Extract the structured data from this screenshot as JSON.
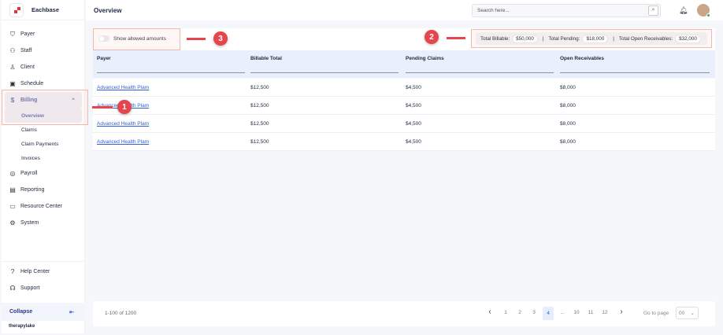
{
  "brand": "Eachbase",
  "sidebar": {
    "items": [
      {
        "label": "Payer",
        "icon": "shield-icon"
      },
      {
        "label": "Staff",
        "icon": "staff-icon"
      },
      {
        "label": "Client",
        "icon": "client-icon"
      },
      {
        "label": "Schedule",
        "icon": "calendar-icon"
      },
      {
        "label": "Billing",
        "icon": "billing-icon"
      }
    ],
    "billing_sub": [
      "Overview",
      "Claims",
      "Claim Payments",
      "Invoices"
    ],
    "items2": [
      {
        "label": "Payroll",
        "icon": "payroll-icon"
      },
      {
        "label": "Reporting",
        "icon": "report-icon"
      },
      {
        "label": "Resource Center",
        "icon": "folder-icon"
      },
      {
        "label": "System",
        "icon": "gear-icon"
      }
    ],
    "help": "Help Center",
    "support": "Support",
    "collapse": "Collapse",
    "footer_logo": "therapylake"
  },
  "header": {
    "title": "Overview",
    "search_placeholder": "Search here..."
  },
  "toggle_label": "Show allowed amounts",
  "totals": {
    "billable_label": "Total Billable:",
    "billable": "$50,000",
    "pending_label": "Total Pending:",
    "pending": "$18,000",
    "open_label": "Total Open Receivables:",
    "open": "$32,000",
    "sep": "|"
  },
  "table": {
    "columns": [
      "Payer",
      "Billable Total",
      "Pending Claims",
      "Open Receivables"
    ],
    "rows": [
      [
        "Advanced Health Plam",
        "$12,500",
        "$4,500",
        "$8,000"
      ],
      [
        "Advanced Health Plam",
        "$12,500",
        "$4,500",
        "$8,000"
      ],
      [
        "Advanced Health Plam",
        "$12,500",
        "$4,500",
        "$8,000"
      ],
      [
        "Advanced Health Plam",
        "$12,500",
        "$4,500",
        "$8,000"
      ]
    ]
  },
  "pagination": {
    "range": "1-100 of 1200",
    "pages": [
      "1",
      "2",
      "3",
      "4",
      "...",
      "10",
      "11",
      "12"
    ],
    "current": "4",
    "goto_label": "Go to page",
    "goto_value": "00"
  },
  "annotations": [
    "1",
    "2",
    "3"
  ],
  "colors": {
    "accent": "#2f5fd8",
    "annotation": "#e5454d",
    "header_bg": "#e9effb"
  }
}
